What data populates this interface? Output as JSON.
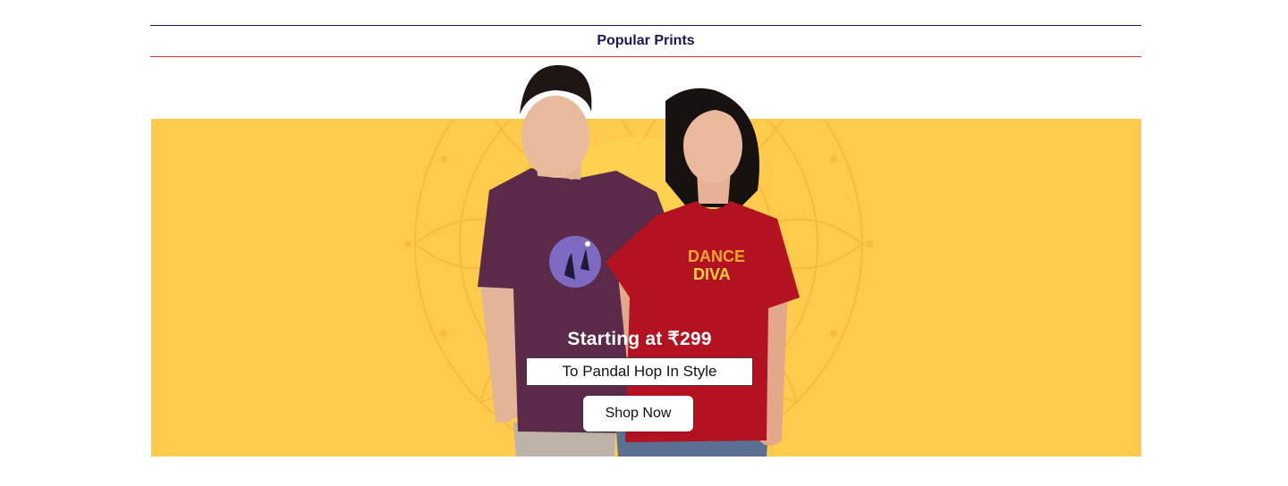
{
  "section": {
    "title": "Popular Prints"
  },
  "banner": {
    "price_text": "Starting at ₹299",
    "tagline": "To Pandal Hop In Style",
    "cta_label": "Shop Now",
    "tshirt_print_text": [
      "DANCE",
      "DIVA"
    ],
    "colors": {
      "background": "#fecb4d",
      "title": "#1b1553",
      "rule_top": "#1b1553",
      "rule_bottom": "#c0392b",
      "purple_tee": "#5b2a49",
      "red_tee": "#b31220"
    }
  }
}
